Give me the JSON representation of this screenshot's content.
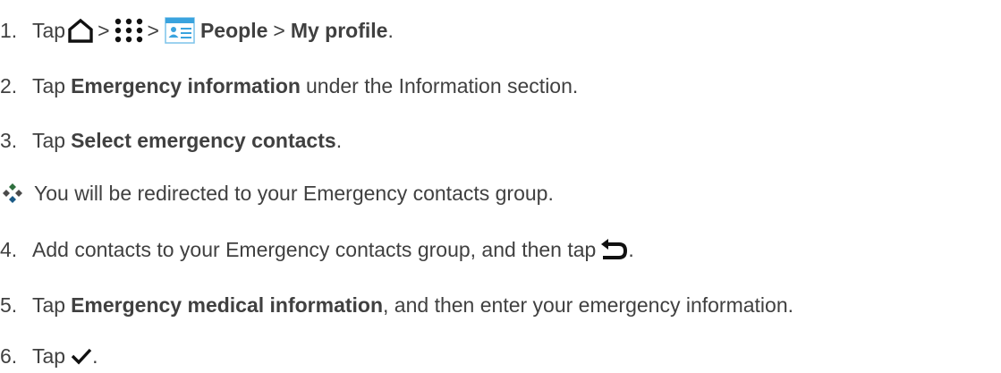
{
  "steps": [
    {
      "num": "1.",
      "tap": "Tap",
      "sep1": ">",
      "sep2": ">",
      "people": "People",
      "sep3": ">",
      "profile": "My profile",
      "end": ".",
      "icons": [
        "home-icon",
        "apps-grid-icon",
        "people-app-icon"
      ]
    },
    {
      "num": "2.",
      "tap": "Tap",
      "bold": "Emergency information",
      "rest": "under the Information section."
    },
    {
      "num": "3.",
      "tap": "Tap",
      "bold": "Select emergency contacts",
      "rest": "."
    },
    {
      "num": "4.",
      "text": "Add contacts to your Emergency contacts group, and then tap",
      "end": ".",
      "icon": "back-icon"
    },
    {
      "num": "5.",
      "tap": "Tap",
      "bold": "Emergency medical information",
      "rest": ", and then enter your emergency information."
    },
    {
      "num": "6.",
      "tap": "Tap",
      "end": ".",
      "icon": "checkmark-icon"
    }
  ],
  "note": {
    "text": "You will be redirected to your Emergency contacts group.",
    "icon": "bullet-diamond-icon"
  },
  "colors": {
    "text": "#404040",
    "icon_blue": "#3aa3de"
  }
}
